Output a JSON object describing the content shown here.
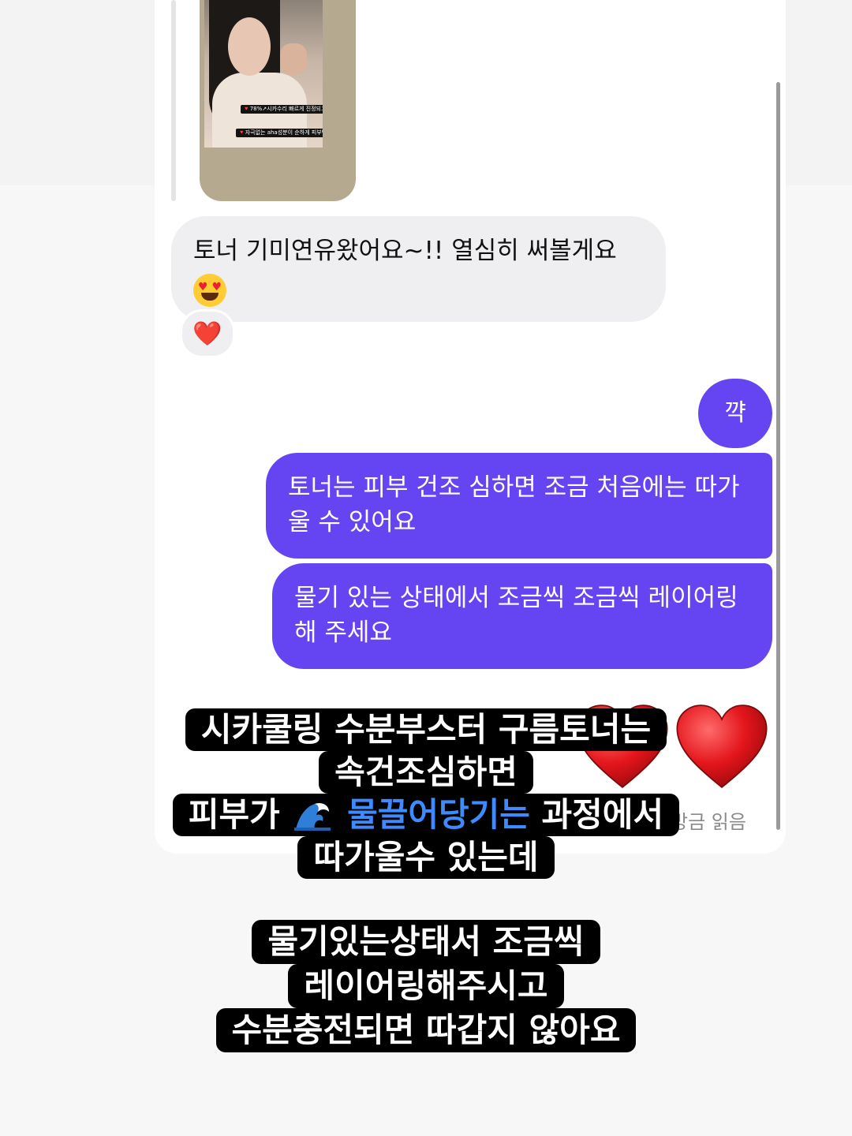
{
  "shared_post": {
    "captions": [
      "🔻78%↗시카수리 빠르게 진정되고",
      "🔻자극없는 aha성분이 순하게 피부턴오버⬆️"
    ]
  },
  "messages": {
    "incoming_text": "토너 기미연유왔어요~!! 열심히 써볼게요",
    "incoming_emoji": "heart-eyes-emoji",
    "reaction": "❤️",
    "outgoing_small": "꺅",
    "outgoing_1": "토너는 피부 건조 심하면 조금 처음에는 따가울 수 있어요",
    "outgoing_2": "물기 있는 상태에서 조금씩 조금씩 레이어링 해 주세요",
    "hearts": [
      "❤️",
      "❤️"
    ],
    "read_status": "방금 읽음"
  },
  "story_overlay": {
    "block1": {
      "line1": "시카쿨링 수분부스터 구름토너는",
      "line2": "속건조심하면",
      "line3_prefix": "피부가",
      "line3_emoji": "wave-emoji",
      "line3_highlight": "물끌어당기는",
      "line3_suffix": "과정에서",
      "line4": "따가울수 있는데"
    },
    "block2": {
      "line1": "물기있는상태서 조금씩",
      "line2": "레이어링해주시고",
      "line3": "수분충전되면 따갑지 않아요"
    }
  },
  "colors": {
    "outgoing_bubble": "#6545f2",
    "incoming_bubble": "#efeff2",
    "highlight_text": "#3d8bff",
    "heart": "#e81c24"
  }
}
